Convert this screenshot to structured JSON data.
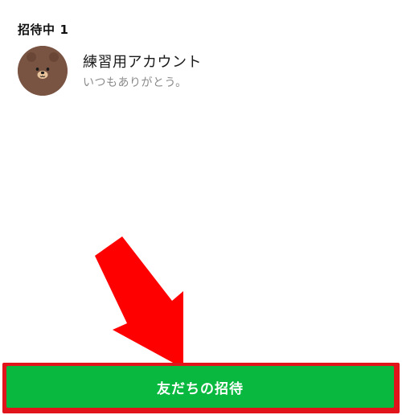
{
  "invites": {
    "header_label": "招待中",
    "header_count": "1",
    "members": [
      {
        "name": "練習用アカウント",
        "status": "いつもありがとう。",
        "avatar": "brown-bear-avatar"
      }
    ]
  },
  "footer": {
    "invite_button_label": "友だちの招待",
    "button_color": "#09b83e"
  },
  "annotation": {
    "arrow_color": "#ff0000",
    "frame_color": "#e1141b"
  }
}
